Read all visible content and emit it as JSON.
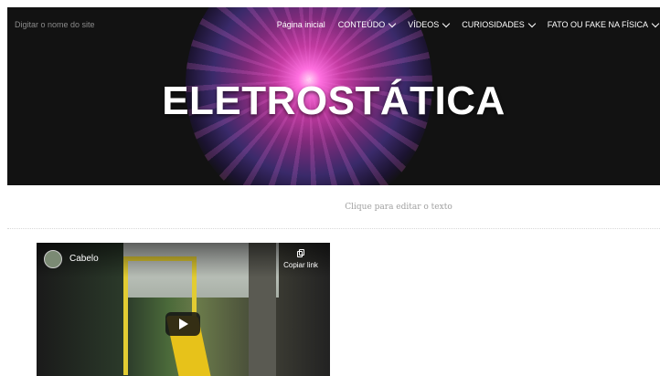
{
  "header": {
    "site_name": "Digitar o nome do site",
    "nav": [
      {
        "label": "Página inicial",
        "has_dropdown": false
      },
      {
        "label": "CONTEÚDO",
        "has_dropdown": true
      },
      {
        "label": "VÍDEOS",
        "has_dropdown": true
      },
      {
        "label": "CURIOSIDADES",
        "has_dropdown": true
      },
      {
        "label": "FATO OU FAKE NA FÍSICA",
        "has_dropdown": true
      }
    ]
  },
  "hero": {
    "title": "ELETROSTÁTICA"
  },
  "content": {
    "edit_hint": "Clique para editar o texto"
  },
  "video": {
    "title": "Cabelo",
    "copy_link_label": "Copiar link",
    "icons": {
      "avatar": "channel-avatar",
      "copy": "copy-icon",
      "play": "play-icon"
    }
  },
  "colors": {
    "hero_bg": "#121212",
    "nav_text": "#ffffff",
    "hint_text": "#a0a0a0"
  }
}
